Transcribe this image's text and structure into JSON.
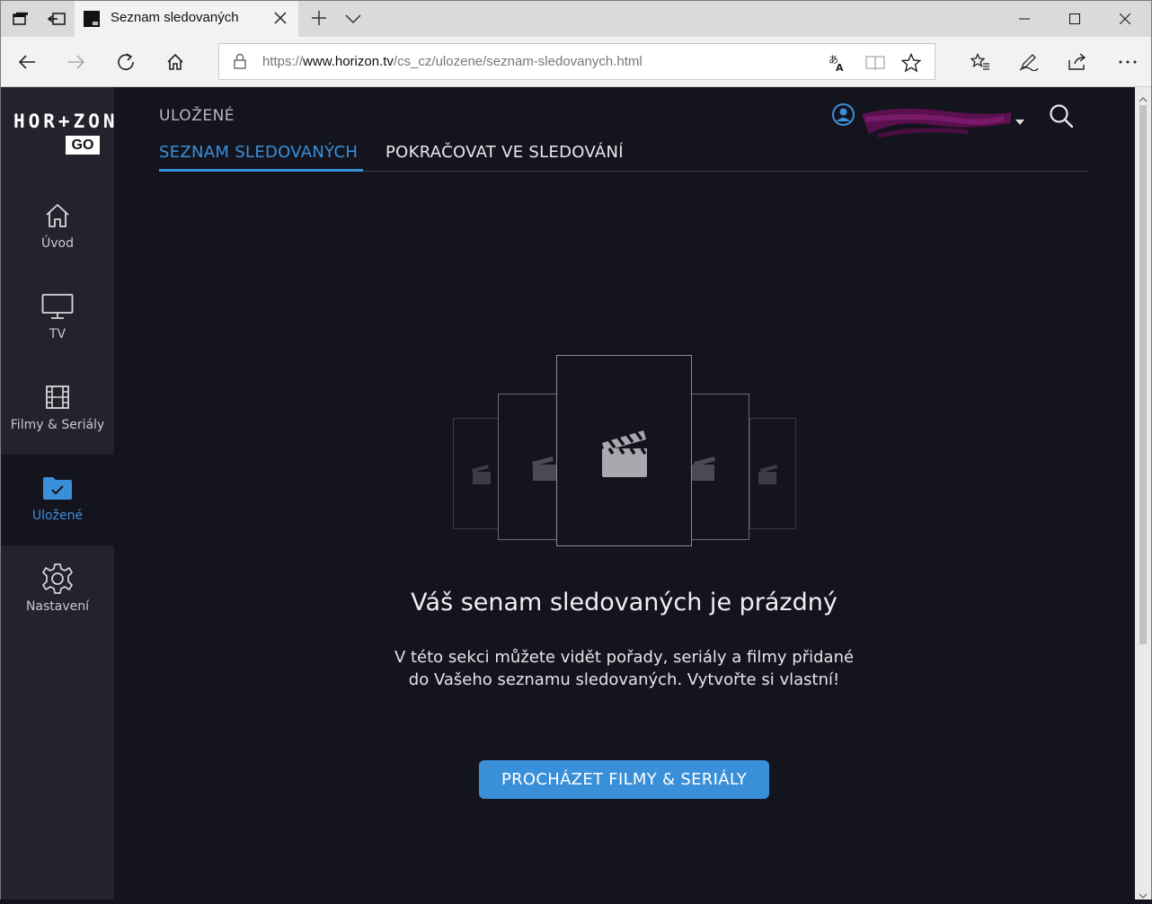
{
  "browser": {
    "tab_title": "Seznam sledovaných",
    "url_prefix": "https://",
    "url_domain": "www.horizon.tv",
    "url_path": "/cs_cz/ulozene/seznam-sledovanych.html"
  },
  "logo": {
    "text": "HOR+ZON",
    "badge": "GO"
  },
  "sidebar": {
    "items": [
      {
        "label": "Úvod",
        "icon": "home-icon"
      },
      {
        "label": "TV",
        "icon": "tv-icon"
      },
      {
        "label": "Filmy & Seriály",
        "icon": "film-icon"
      },
      {
        "label": "Uložené",
        "icon": "folder-check-icon",
        "active": true
      },
      {
        "label": "Nastavení",
        "icon": "gear-icon"
      }
    ]
  },
  "header": {
    "section": "ULOŽENÉ",
    "tabs": [
      {
        "label": "SEZNAM SLEDOVANÝCH",
        "active": true
      },
      {
        "label": "POKRAČOVAT VE SLEDOVÁNÍ",
        "active": false
      }
    ]
  },
  "empty_state": {
    "title": "Váš senam sledovaných je prázdný",
    "description": "V této sekci můžete vidět pořady, seriály a filmy přidané do Vašeho seznamu sledovaných. Vytvořte si vlastní!",
    "button": "PROCHÁZET FILMY & SERIÁLY"
  },
  "colors": {
    "accent": "#3a8fd9",
    "background": "#14141e",
    "sidebar": "#23232d"
  }
}
